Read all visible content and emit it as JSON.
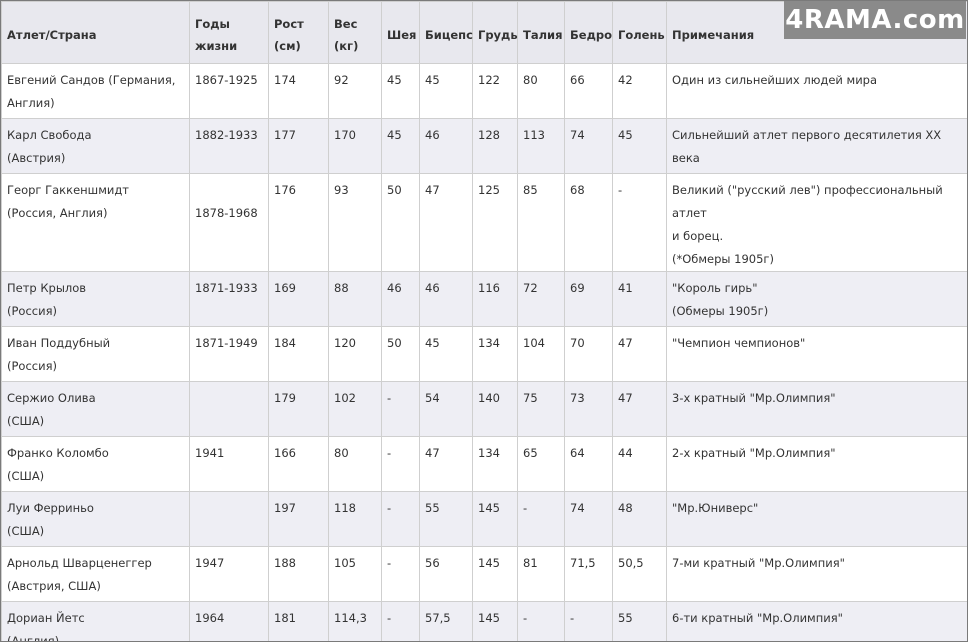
{
  "watermark": "4RAMA.com",
  "table": {
    "headers": {
      "athlete": "Атлет/Страна",
      "years_1": "Годы",
      "years_2": "жизни",
      "height_1": "Рост",
      "height_2": "(см)",
      "weight_1": "Вес",
      "weight_2": "(кг)",
      "neck": "Шея",
      "biceps": "Бицепс",
      "chest": "Грудь",
      "waist": "Талия",
      "thigh": "Бедро",
      "calf": "Голень",
      "notes": "Примечания"
    },
    "rows": [
      {
        "name": "Евгений Сандов (Германия,",
        "country": "Англия)",
        "years": "1867-1925",
        "height": "174",
        "weight": "92",
        "neck": "45",
        "biceps": "45",
        "chest": "122",
        "waist": "80",
        "thigh": "66",
        "calf": "42",
        "note1": "Один из сильнейших людей мира",
        "note2": "",
        "note3": ""
      },
      {
        "name": "Карл Свобода",
        "country": "(Австрия)",
        "years": "1882-1933",
        "height": "177",
        "weight": "170",
        "neck": "45",
        "biceps": "46",
        "chest": "128",
        "waist": "113",
        "thigh": "74",
        "calf": "45",
        "note1": "Сильнейший атлет первого десятилетия XX века",
        "note2": "",
        "note3": ""
      },
      {
        "name": "Георг Гаккеншмидт",
        "country": "(Россия, Англия)",
        "years": "1878-1968",
        "height": "176",
        "weight": "93",
        "neck": "50",
        "biceps": "47",
        "chest": "125",
        "waist": "85",
        "thigh": "68",
        "calf": "-",
        "note1": "Великий (\"русский лев\") профессиональный атлет",
        "note2": "и борец.",
        "note3": "(*Обмеры 1905г)"
      },
      {
        "name": "Петр Крылов",
        "country": "(Россия)",
        "years": "1871-1933",
        "height": "169",
        "weight": "88",
        "neck": "46",
        "biceps": "46",
        "chest": "116",
        "waist": "72",
        "thigh": "69",
        "calf": "41",
        "note1": "\"Король гирь\"",
        "note2": "(Обмеры 1905г)",
        "note3": ""
      },
      {
        "name": "Иван Поддубный",
        "country": "(Россия)",
        "years": "1871-1949",
        "height": "184",
        "weight": "120",
        "neck": "50",
        "biceps": "45",
        "chest": "134",
        "waist": "104",
        "thigh": "70",
        "calf": "47",
        "note1": "\"Чемпион чемпионов\"",
        "note2": "",
        "note3": ""
      },
      {
        "name": "Сержио Олива",
        "country": "(США)",
        "years": "",
        "height": "179",
        "weight": "102",
        "neck": "-",
        "biceps": "54",
        "chest": "140",
        "waist": "75",
        "thigh": "73",
        "calf": "47",
        "note1": "3-х кратный \"Мр.Олимпия\"",
        "note2": "",
        "note3": ""
      },
      {
        "name": "Франко Коломбо",
        "country": "(США)",
        "years": "1941",
        "height": "166",
        "weight": "80",
        "neck": "-",
        "biceps": "47",
        "chest": "134",
        "waist": "65",
        "thigh": "64",
        "calf": "44",
        "note1": "2-х кратный \"Мр.Олимпия\"",
        "note2": "",
        "note3": ""
      },
      {
        "name": "Луи Ферриньо",
        "country": "(США)",
        "years": "",
        "height": "197",
        "weight": "118",
        "neck": "-",
        "biceps": "55",
        "chest": "145",
        "waist": "-",
        "thigh": "74",
        "calf": "48",
        "note1": "\"Мр.Юниверс\"",
        "note2": "",
        "note3": ""
      },
      {
        "name": "Арнольд Шварценеггер",
        "country": "(Австрия, США)",
        "years": "1947",
        "height": "188",
        "weight": "105",
        "neck": "-",
        "biceps": "56",
        "chest": "145",
        "waist": "81",
        "thigh": "71,5",
        "calf": "50,5",
        "note1": "7-ми кратный \"Мр.Олимпия\"",
        "note2": "",
        "note3": ""
      },
      {
        "name": "Дориан Йетс",
        "country": "(Англия)",
        "years": "1964",
        "height": "181",
        "weight": "114,3",
        "neck": "-",
        "biceps": "57,5",
        "chest": "145",
        "waist": "-",
        "thigh": "-",
        "calf": "55",
        "note1": "6-ти кратный \"Мр.Олимпия\"",
        "note2": "",
        "note3": ""
      }
    ]
  }
}
